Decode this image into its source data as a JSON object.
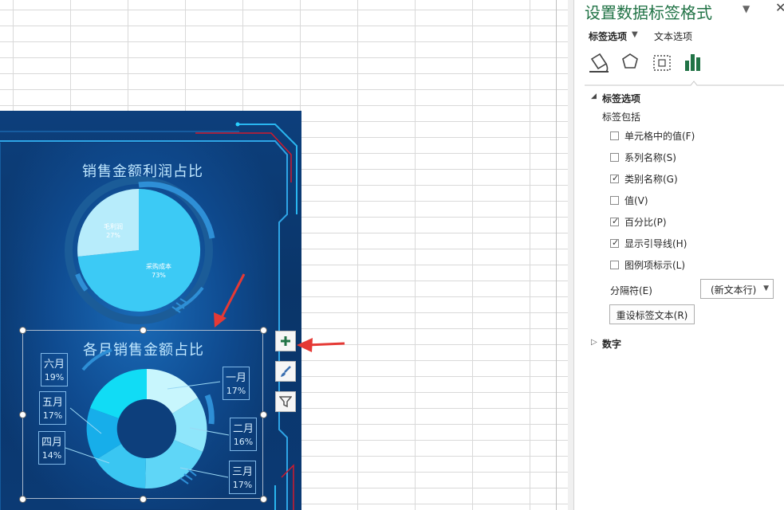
{
  "dashboard": {
    "pie_title": "销售金额利润占比",
    "pie_labels": [
      {
        "name": "毛利润",
        "pct": "27%"
      },
      {
        "name": "采购成本",
        "pct": "73%"
      }
    ],
    "donut_title": "各月销售金额占比",
    "donut_labels": [
      {
        "name": "六月",
        "pct": "19%"
      },
      {
        "name": "五月",
        "pct": "17%"
      },
      {
        "name": "四月",
        "pct": "14%"
      },
      {
        "name": "一月",
        "pct": "17%"
      },
      {
        "name": "二月",
        "pct": "16%"
      },
      {
        "name": "三月",
        "pct": "17%"
      }
    ],
    "colors": {
      "bg": "#0a3569",
      "pie_main": "#3ccaf5",
      "pie_slice": "#b7ecfb",
      "accent_red": "#e02030"
    }
  },
  "float_buttons": {
    "add": "plus-icon",
    "style": "brush-icon",
    "filter": "funnel-icon"
  },
  "pane": {
    "title": "设置数据标签格式",
    "tab_label_options": "标签选项",
    "tab_text_options": "文本选项",
    "icons": [
      "fill-line-icon",
      "effects-icon",
      "size-properties-icon",
      "label-options-icon"
    ],
    "section_label_options": "标签选项",
    "label_contains": "标签包括",
    "checkboxes": [
      {
        "label": "单元格中的值(F)",
        "checked": false
      },
      {
        "label": "系列名称(S)",
        "checked": false
      },
      {
        "label": "类别名称(G)",
        "checked": true
      },
      {
        "label": "值(V)",
        "checked": false
      },
      {
        "label": "百分比(P)",
        "checked": true
      },
      {
        "label": "显示引导线(H)",
        "checked": true
      },
      {
        "label": "图例项标示(L)",
        "checked": false
      }
    ],
    "separator_label": "分隔符(E)",
    "separator_value": "(新文本行)",
    "reset_button": "重设标签文本(R)",
    "section_number": "数字"
  }
}
